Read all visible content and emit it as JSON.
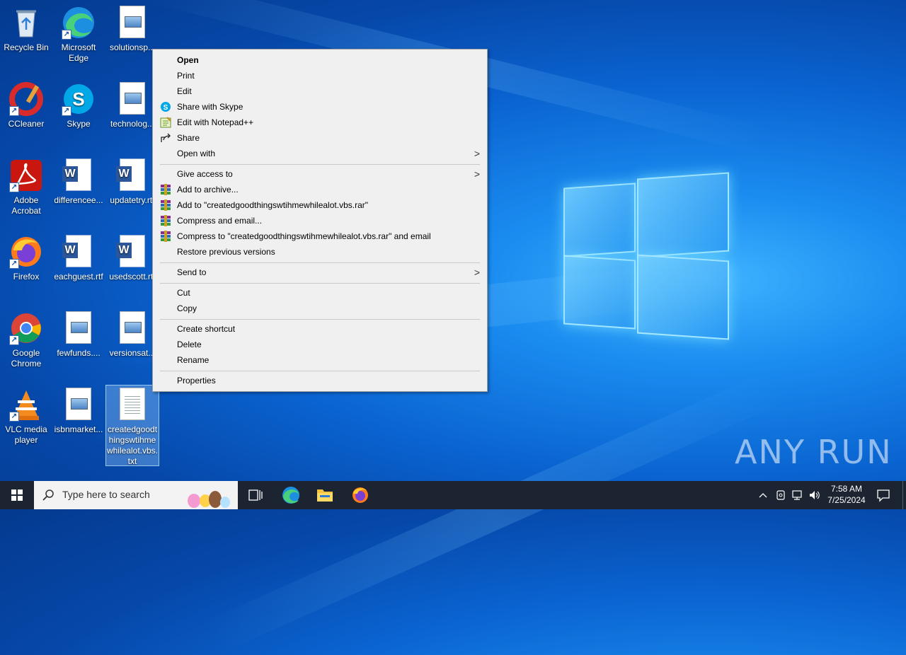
{
  "desktop": {
    "icons": [
      {
        "label": "Recycle Bin"
      },
      {
        "label": "Microsoft Edge"
      },
      {
        "label": "solutionsp..."
      },
      {
        "label": "CCleaner"
      },
      {
        "label": "Skype"
      },
      {
        "label": "technolog..."
      },
      {
        "label": "Adobe Acrobat"
      },
      {
        "label": "differencee..."
      },
      {
        "label": "updatetry.rtf"
      },
      {
        "label": "Firefox"
      },
      {
        "label": "eachguest.rtf"
      },
      {
        "label": "usedscott.rtf"
      },
      {
        "label": "Google Chrome"
      },
      {
        "label": "fewfunds...."
      },
      {
        "label": "versionsat..."
      },
      {
        "label": "VLC media player"
      },
      {
        "label": "isbnmarket..."
      },
      {
        "label": "createdgoodthingswtihmewhilealot.vbs.txt"
      }
    ]
  },
  "context_menu": {
    "items": [
      {
        "label": "Open"
      },
      {
        "label": "Print"
      },
      {
        "label": "Edit"
      },
      {
        "label": "Share with Skype"
      },
      {
        "label": "Edit with Notepad++"
      },
      {
        "label": "Share"
      },
      {
        "label": "Open with"
      },
      {
        "label": "Give access to"
      },
      {
        "label": "Add to archive..."
      },
      {
        "label": "Add to \"createdgoodthingswtihmewhilealot.vbs.rar\""
      },
      {
        "label": "Compress and email..."
      },
      {
        "label": "Compress to \"createdgoodthingswtihmewhilealot.vbs.rar\" and email"
      },
      {
        "label": "Restore previous versions"
      },
      {
        "label": "Send to"
      },
      {
        "label": "Cut"
      },
      {
        "label": "Copy"
      },
      {
        "label": "Create shortcut"
      },
      {
        "label": "Delete"
      },
      {
        "label": "Rename"
      },
      {
        "label": "Properties"
      }
    ]
  },
  "taskbar": {
    "search_placeholder": "Type here to search",
    "time": "7:58 AM",
    "date": "7/25/2024"
  },
  "watermark": "ANY RUN"
}
